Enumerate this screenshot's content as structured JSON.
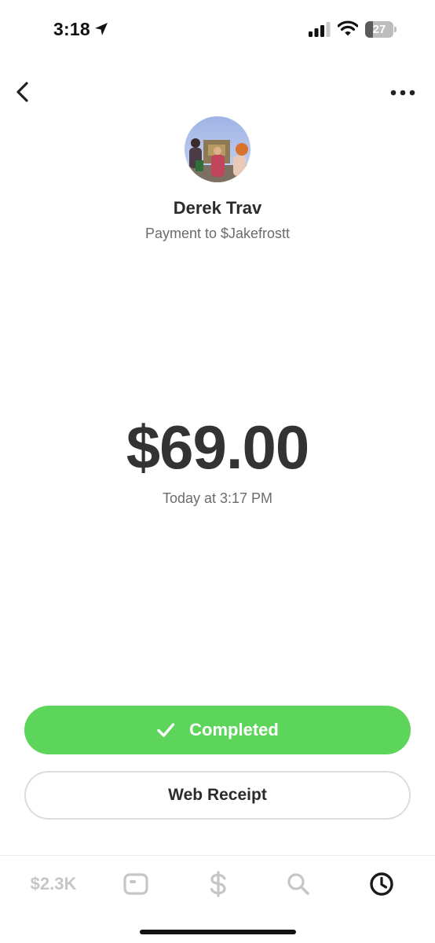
{
  "status_bar": {
    "time": "3:18",
    "battery_level": "27",
    "battery_percent": 27
  },
  "nav": {
    "back_icon": "chevron-left-icon",
    "more_icon": "ellipsis-icon"
  },
  "payment": {
    "recipient_name": "Derek Trav",
    "description": "Payment to $Jakefrostt",
    "amount": "$69.00",
    "timestamp": "Today at 3:17 PM",
    "status_label": "Completed",
    "receipt_label": "Web Receipt"
  },
  "tab_bar": {
    "balance_label": "$2.3K",
    "tabs": [
      {
        "name": "balance",
        "icon": "balance-text"
      },
      {
        "name": "card",
        "icon": "card-icon"
      },
      {
        "name": "pay",
        "icon": "dollar-icon"
      },
      {
        "name": "search",
        "icon": "search-icon"
      },
      {
        "name": "activity",
        "icon": "clock-icon",
        "active": true
      }
    ]
  },
  "colors": {
    "accent_green": "#5dd55b",
    "text_dark": "#333333",
    "text_muted": "#6b6b6b",
    "tab_inactive": "#c6c6c6",
    "tab_active": "#1a1a1a"
  }
}
